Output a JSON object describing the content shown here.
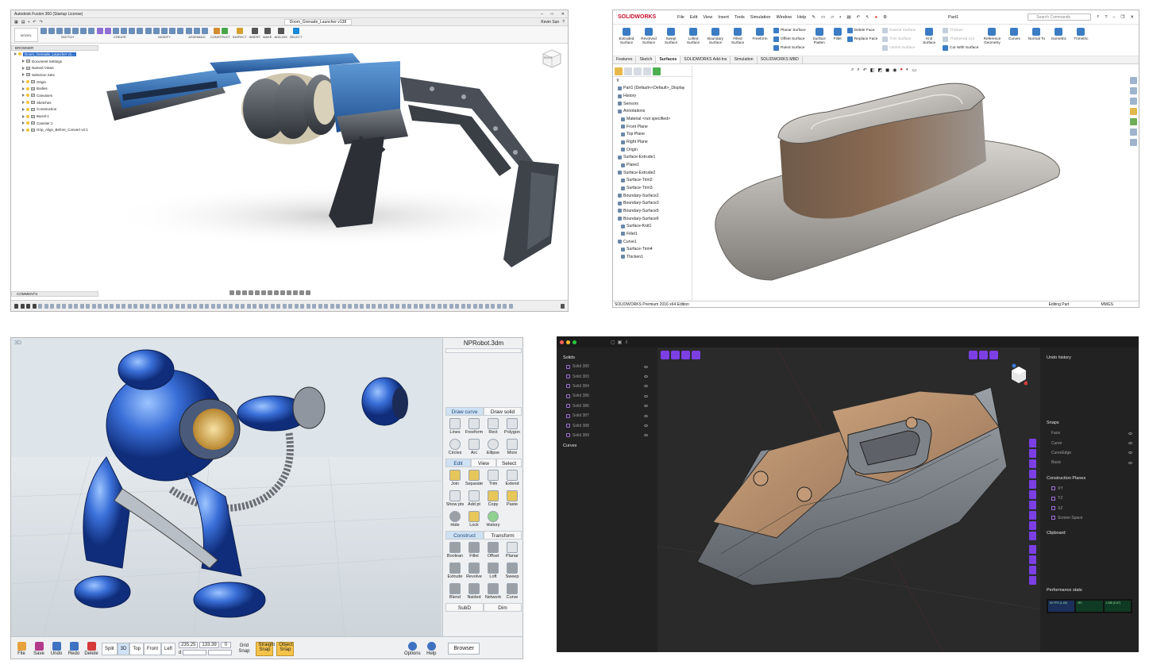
{
  "fusion": {
    "title": "Autodesk Fusion 360 (Startup License)",
    "doc_tab": "Doom_Grenade_Launcher v138",
    "user": "Kevin Sun",
    "workspace": "MODEL",
    "ribbon_groups": [
      "SKETCH",
      "CREATE",
      "MODIFY",
      "ASSEMBLE",
      "CONSTRUCT",
      "INSPECT",
      "INSERT",
      "MAKE",
      "ADD-INS",
      "SELECT"
    ],
    "browser_title": "BROWSER",
    "browser_root": "Doom_Grenade_Launcher v1...",
    "browser_items": [
      "Document Settings",
      "Named Views",
      "Selection Sets",
      "Origin",
      "Bodies",
      "Canvases",
      "Sketches",
      "Construction",
      "Barrel:1",
      "Canister:1",
      "Grip_Align_Before_Convert v2:1"
    ],
    "comments": "COMMENTS",
    "navcube_label": "RIGHT"
  },
  "solidworks": {
    "brand": "SOLIDWORKS",
    "menus": [
      "File",
      "Edit",
      "View",
      "Insert",
      "Tools",
      "Simulation",
      "Window",
      "Help"
    ],
    "doc_title": "Part1",
    "search_placeholder": "Search Commands",
    "commands": [
      {
        "label": "Extruded Surface",
        "enabled": true
      },
      {
        "label": "Revolved Surface",
        "enabled": true
      },
      {
        "label": "Swept Surface",
        "enabled": true
      },
      {
        "label": "Lofted Surface",
        "enabled": true
      },
      {
        "label": "Boundary Surface",
        "enabled": true
      },
      {
        "label": "Filled Surface",
        "enabled": true
      },
      {
        "label": "Freeform",
        "enabled": true
      }
    ],
    "stack1": [
      "Planar Surface",
      "Offset Surface",
      "Ruled Surface"
    ],
    "commands2": [
      {
        "label": "Surface Flatten",
        "enabled": true
      },
      {
        "label": "Fillet",
        "enabled": true
      }
    ],
    "stack2": [
      "Delete Face",
      "Replace Face"
    ],
    "stack3": [
      "Extend Surface",
      "Trim Surface",
      "Untrim Surface"
    ],
    "commands3": [
      {
        "label": "Knit Surface",
        "enabled": true
      }
    ],
    "stack4": [
      "Thicken",
      "Thickened Cut",
      "Cut With Surface"
    ],
    "commands4": [
      {
        "label": "Reference Geometry",
        "enabled": true
      },
      {
        "label": "Curves",
        "enabled": true
      },
      {
        "label": "Normal To",
        "enabled": true
      },
      {
        "label": "Isometric",
        "enabled": true
      },
      {
        "label": "Trimetric",
        "enabled": true
      }
    ],
    "tabs": [
      "Features",
      "Sketch",
      "Surfaces",
      "SOLIDWORKS Add-Ins",
      "Simulation",
      "SOLIDWORKS MBD"
    ],
    "active_tab": "Surfaces",
    "tree_root": "Part1  (Default<<Default>_Display",
    "tree": [
      "History",
      "Sensors",
      "Annotations",
      "Material <not specified>",
      "Front Plane",
      "Top Plane",
      "Right Plane",
      "Origin",
      "Surface-Extrude1",
      "Plane1",
      "Surface-Extrude2",
      "Surface-Trim2",
      "Surface-Trim3",
      "Boundary-Surface2",
      "Boundary-Surface3",
      "Boundary-Surface5",
      "Boundary-Surface6",
      "Surface-Knit1",
      "Fillet1",
      "Curve1",
      "Surface-Trim4",
      "Thicken1"
    ],
    "status_left": "SOLIDWORKS Premium 2016 x64 Edition",
    "status_mid": "Editing Part",
    "status_units": "MMGS"
  },
  "nprobot": {
    "file_title": "NPRobot.3dm",
    "view_tag": "3D",
    "tabs_draw": [
      "Draw curve",
      "Draw solid"
    ],
    "draw_tools": [
      "Lines",
      "Freeform",
      "Rect",
      "Polygon",
      "Circles",
      "Arc",
      "Ellipse",
      "More"
    ],
    "tabs_edit": [
      "Edit",
      "View",
      "Select"
    ],
    "edit_tools": [
      "Join",
      "Separate",
      "Trim",
      "Extend",
      "Show pts",
      "Add pt",
      "Copy",
      "Paste",
      "Hide",
      "Lock",
      "History"
    ],
    "tabs_construct": [
      "Construct",
      "Transform"
    ],
    "construct_tools": [
      "Boolean",
      "Fillet",
      "Offset",
      "Planar",
      "Extrude",
      "Revolve",
      "Loft",
      "Sweep",
      "Blend",
      "Nsided",
      "Network",
      "Curve"
    ],
    "tabs_sub": [
      "SubD",
      "Dim"
    ],
    "bottom_buttons": [
      "File",
      "Save",
      "Undo",
      "Redo",
      "Delete"
    ],
    "views": [
      "Split",
      "3D",
      "Top",
      "Front",
      "Left"
    ],
    "active_view": "3D",
    "coord_x": "235.25",
    "coord_y": "133.39",
    "coord_z": "0",
    "coord_d": "d",
    "grid_snap": "Grid Snap",
    "straight_snap": "Straight Snap",
    "object_snap": "Object Snap",
    "options": "Options",
    "help": "Help",
    "browser": "Browser"
  },
  "plasticity": {
    "solids_header": "Solids",
    "solids": [
      "Solid 380",
      "Solid 383",
      "Solid 384",
      "Solid 386",
      "Solid 386",
      "Solid 387",
      "Solid 388",
      "Solid 389"
    ],
    "curves_header": "Curves",
    "undo_header": "Undo history",
    "snaps_header": "Snaps",
    "snaps": [
      "Face",
      "Curve",
      "CurveEdge",
      "Basic"
    ],
    "planes_header": "Construction Planes",
    "planes": [
      "XY",
      "YZ",
      "XZ",
      "Screen Space"
    ],
    "clipboard_header": "Clipboard",
    "perf_header": "Performance stats",
    "perf_labels": [
      "60 FPS (1-60)",
      "MS",
      "4 MB (0-67)"
    ]
  }
}
